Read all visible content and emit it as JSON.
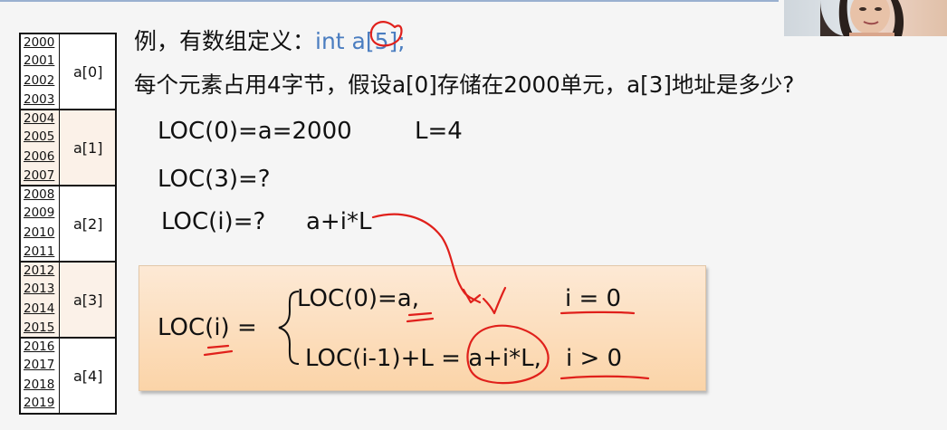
{
  "memory": {
    "elements": [
      {
        "label": "a[0]",
        "addresses": [
          "2000",
          "2001",
          "2002",
          "2003"
        ]
      },
      {
        "label": "a[1]",
        "addresses": [
          "2004",
          "2005",
          "2006",
          "2007"
        ]
      },
      {
        "label": "a[2]",
        "addresses": [
          "2008",
          "2009",
          "2010",
          "2011"
        ]
      },
      {
        "label": "a[3]",
        "addresses": [
          "2012",
          "2013",
          "2014",
          "2015"
        ]
      },
      {
        "label": "a[4]",
        "addresses": [
          "2016",
          "2017",
          "2018",
          "2019"
        ]
      }
    ]
  },
  "slide": {
    "title_prefix": "例，有数组定义：",
    "title_code": "int a[5];",
    "question": "每个元素占用4字节，假设a[0]存储在2000单元，a[3]地址是多少?",
    "loc0": "LOC(0)=a=2000",
    "L": "L=4",
    "loc3": "LOC(3)=?",
    "loci_q": "LOC(i)=?",
    "loci_expr": "a+i*L"
  },
  "formula_box": {
    "lhs": "LOC(i) =",
    "case1_expr": "LOC(0)=a,",
    "case1_cond": "i = 0",
    "case2_expr": "LOC(i-1)+L = a+i*L,",
    "case2_cond": "i > 0"
  },
  "colors": {
    "code_blue": "#4a7dc0",
    "annotation_red": "#e0201b",
    "box_top": "#fde9d5",
    "box_bottom": "#fbd4a8"
  }
}
